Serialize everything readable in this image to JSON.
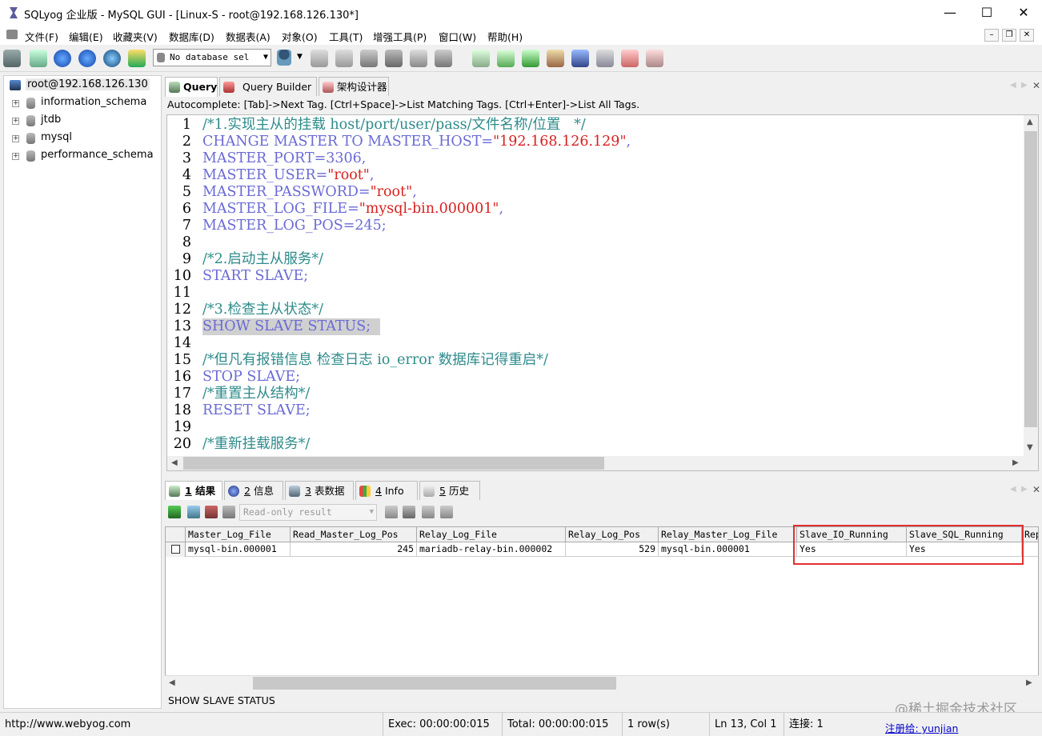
{
  "window": {
    "title": "SQLyog 企业版 - MySQL GUI - [Linux-S - root@192.168.126.130*]",
    "minimize": "—",
    "maximize": "☐",
    "close": "✕"
  },
  "menu": [
    "文件(F)",
    "编辑(E)",
    "收藏夹(V)",
    "数据库(D)",
    "数据表(A)",
    "对象(O)",
    "工具(T)",
    "增强工具(P)",
    "窗口(W)",
    "帮助(H)"
  ],
  "toolbar": {
    "db_select": "No database sel"
  },
  "tree": {
    "root": "root@192.168.126.130",
    "databases": [
      "information_schema",
      "jtdb",
      "mysql",
      "performance_schema"
    ]
  },
  "tabs": {
    "query": "Query",
    "builder": "Query Builder",
    "schema": "架构设计器"
  },
  "autocomplete": "Autocomplete: [Tab]->Next Tag. [Ctrl+Space]->List Matching Tags. [Ctrl+Enter]->List All Tags.",
  "editor": {
    "line_numbers": [
      "1",
      "2",
      "3",
      "4",
      "5",
      "6",
      "7",
      "8",
      "9",
      "10",
      "11",
      "12",
      "13",
      "14",
      "15",
      "16",
      "17",
      "18",
      "19",
      "20"
    ],
    "l1": "/*1.实现主从的挂载 host/port/user/pass/文件名称/位置   */",
    "l2a": "CHANGE MASTER TO MASTER_HOST=",
    "l2b": "\"192.168.126.129\"",
    "l2c": ",",
    "l3": "MASTER_PORT=3306,",
    "l4a": "MASTER_USER=",
    "l4b": "\"root\"",
    "l4c": ",",
    "l5a": "MASTER_PASSWORD=",
    "l5b": "\"root\"",
    "l5c": ",",
    "l6a": "MASTER_LOG_FILE=",
    "l6b": "\"mysql-bin.000001\"",
    "l6c": ",",
    "l7": "MASTER_LOG_POS=245;",
    "l9": "/*2.启动主从服务*/",
    "l10": "START SLAVE;",
    "l12": "/*3.检查主从状态*/",
    "l13": "SHOW SLAVE STATUS;",
    "l15": "/*但凡有报错信息 检查日志 io_error 数据库记得重启*/",
    "l16": "STOP SLAVE;",
    "l17": "/*重置主从结构*/",
    "l18": "RESET SLAVE;",
    "l20": "/*重新挂载服务*/"
  },
  "result_tabs": [
    {
      "num": "1",
      "label": "结果"
    },
    {
      "num": "2",
      "label": "信息"
    },
    {
      "num": "3",
      "label": "表数据"
    },
    {
      "num": "4",
      "label": "Info"
    },
    {
      "num": "5",
      "label": "历史"
    }
  ],
  "result_toolbar": {
    "mode": "Read-only result"
  },
  "grid": {
    "columns": [
      "Master_Log_File",
      "Read_Master_Log_Pos",
      "Relay_Log_File",
      "Relay_Log_Pos",
      "Relay_Master_Log_File",
      "Slave_IO_Running",
      "Slave_SQL_Running",
      "Rep"
    ],
    "row": [
      "mysql-bin.000001",
      "245",
      "mariadb-relay-bin.000002",
      "529",
      "mysql-bin.000001",
      "Yes",
      "Yes",
      ""
    ]
  },
  "sql_status": "SHOW SLAVE STATUS",
  "status": {
    "url": "http://www.webyog.com",
    "exec": "Exec: 00:00:00:015",
    "total": "Total: 00:00:00:015",
    "rows": "1 row(s)",
    "pos": "Ln 13, Col 1",
    "conn": "连接: 1",
    "reg": "注册给: yunjian"
  },
  "watermark": "@稀土掘金技术社区"
}
